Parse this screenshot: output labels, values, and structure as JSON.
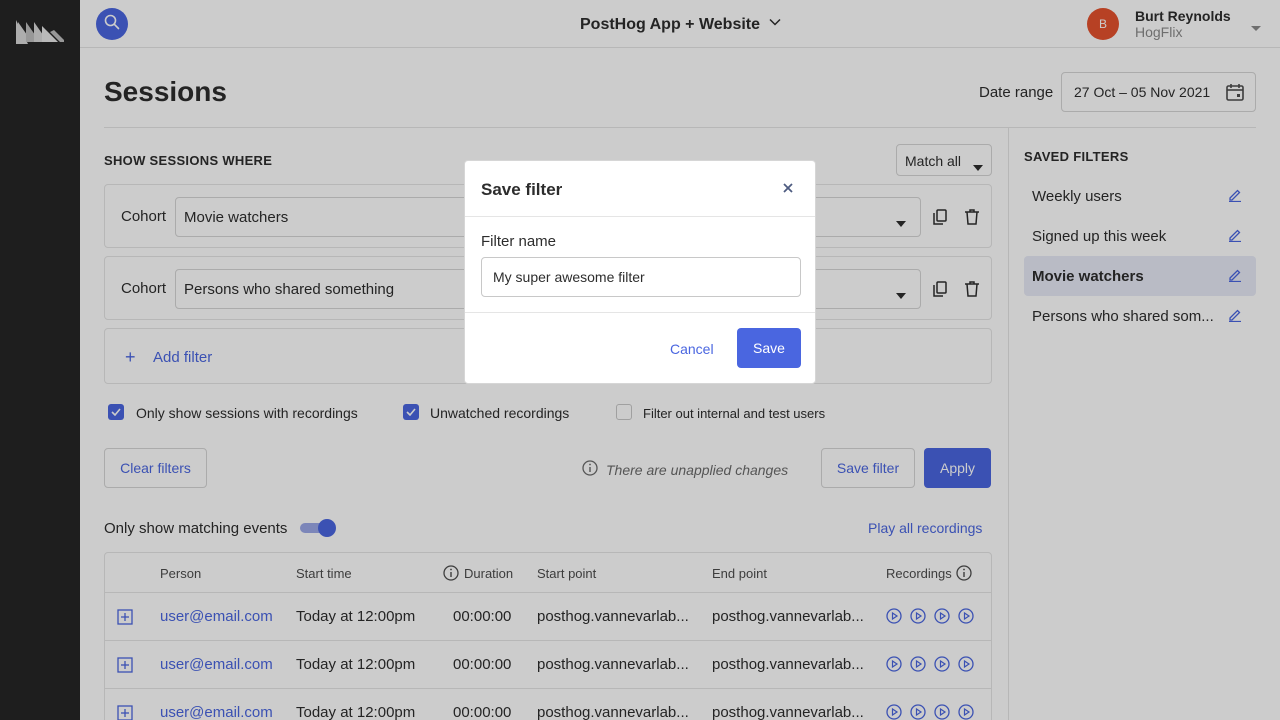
{
  "header": {
    "project_name": "PostHog App + Website",
    "user_initial": "B",
    "user_name": "Burt Reynolds",
    "user_org": "HogFlix"
  },
  "page": {
    "title": "Sessions",
    "date_range_label": "Date range",
    "date_range_value": "27 Oct – 05 Nov 2021"
  },
  "filters": {
    "section_title": "SHOW SESSIONS WHERE",
    "match_value": "Match all",
    "rows": [
      {
        "label": "Cohort",
        "value": "Movie watchers"
      },
      {
        "label": "Cohort",
        "value": "Persons who shared something"
      }
    ],
    "add_filter_label": "Add filter",
    "checkboxes": [
      {
        "label": "Only show sessions with recordings",
        "checked": true
      },
      {
        "label": "Unwatched recordings",
        "checked": true
      },
      {
        "label": "Filter out internal and test users",
        "checked": false
      }
    ],
    "clear_label": "Clear filters",
    "unapplied_text": "There are unapplied changes",
    "save_filter_label": "Save filter",
    "apply_label": "Apply"
  },
  "events": {
    "match_events_label": "Only show matching events",
    "match_events_on": true,
    "play_all_label": "Play all recordings"
  },
  "table": {
    "columns": [
      "Person",
      "Start time",
      "Duration",
      "Start point",
      "End point",
      "Recordings"
    ],
    "rows": [
      {
        "person": "user@email.com",
        "start_time": "Today at 12:00pm",
        "duration": "00:00:00",
        "start_point": "posthog.vannevarlab...",
        "end_point": "posthog.vannevarlab..."
      },
      {
        "person": "user@email.com",
        "start_time": "Today at 12:00pm",
        "duration": "00:00:00",
        "start_point": "posthog.vannevarlab...",
        "end_point": "posthog.vannevarlab..."
      },
      {
        "person": "user@email.com",
        "start_time": "Today at 12:00pm",
        "duration": "00:00:00",
        "start_point": "posthog.vannevarlab...",
        "end_point": "posthog.vannevarlab..."
      }
    ]
  },
  "saved_filters": {
    "title": "SAVED FILTERS",
    "items": [
      {
        "label": "Weekly users",
        "active": false
      },
      {
        "label": "Signed up this week",
        "active": false
      },
      {
        "label": "Movie watchers",
        "active": true
      },
      {
        "label": "Persons who shared som...",
        "active": false
      }
    ]
  },
  "modal": {
    "title": "Save filter",
    "field_label": "Filter name",
    "field_value": "My super awesome filter",
    "cancel_label": "Cancel",
    "save_label": "Save"
  },
  "colors": {
    "accent": "#4a66e0",
    "sidebar": "#262626",
    "avatar": "#e5522d"
  },
  "icons": [
    "logo-icon",
    "search-icon",
    "chevron-down-icon",
    "calendar-icon",
    "copy-icon",
    "trash-icon",
    "plus-icon",
    "check-icon",
    "info-icon",
    "expand-icon",
    "play-icon",
    "edit-icon",
    "close-icon"
  ]
}
